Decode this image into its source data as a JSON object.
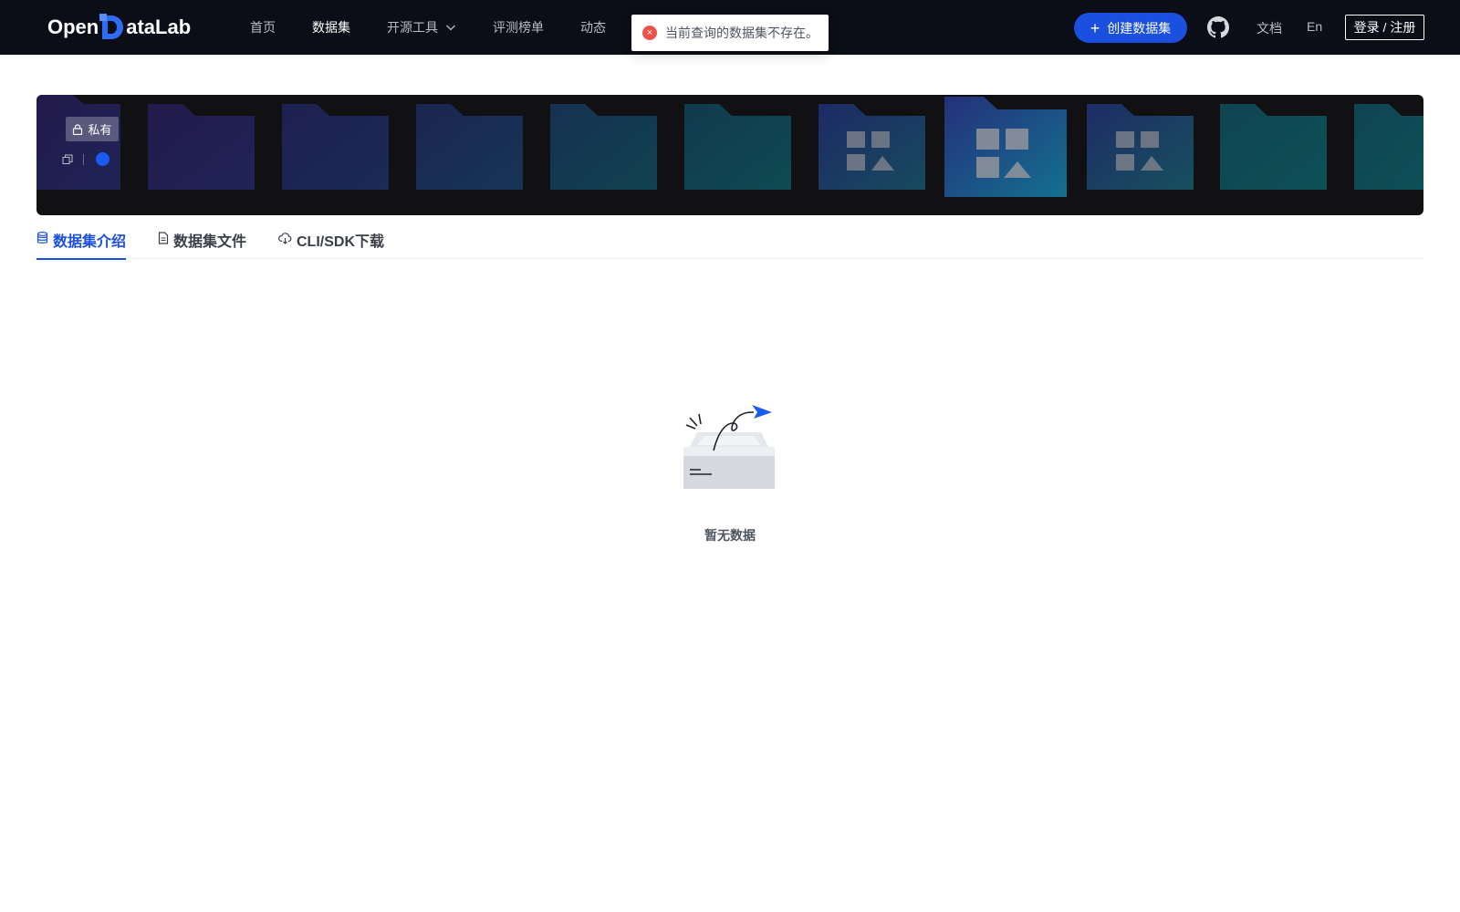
{
  "header": {
    "logo": {
      "prefix": "Open",
      "suffix": "ataLab"
    },
    "nav": [
      {
        "label": "首页",
        "active": false
      },
      {
        "label": "数据集",
        "active": true
      },
      {
        "label": "开源工具",
        "active": false,
        "has_dropdown": true
      },
      {
        "label": "评测榜单",
        "active": false
      },
      {
        "label": "动态",
        "active": false
      }
    ],
    "create_button": "创建数据集",
    "doc_link": "文档",
    "lang_link": "En",
    "login_button": "登录 / 注册",
    "icons": {
      "github": "github-icon",
      "create": "plus-icon",
      "dropdown": "chevron-down-icon"
    }
  },
  "toast": {
    "type": "error",
    "message": "当前查询的数据集不存在。",
    "icon": "close-circle-icon"
  },
  "banner": {
    "visibility_badge": "私有",
    "badge_icon": "lock-icon"
  },
  "tabs": [
    {
      "label": "数据集介绍",
      "icon": "database-icon",
      "active": true
    },
    {
      "label": "数据集文件",
      "icon": "file-icon",
      "active": false
    },
    {
      "label": "CLI/SDK下载",
      "icon": "cloud-download-icon",
      "active": false
    }
  ],
  "empty_state": {
    "text": "暂无数据",
    "illustration": "empty-box-icon"
  },
  "colors": {
    "nav_bg": "#0b0e16",
    "accent": "#1a4fe0",
    "error": "#f0524a",
    "banner_bg": "#111114"
  }
}
